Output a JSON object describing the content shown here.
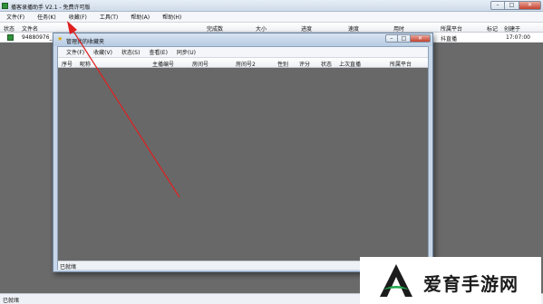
{
  "window": {
    "title": "播客录播助手 V2.1 - 免费许可版"
  },
  "window_controls": {
    "minimize": "–",
    "maximize": "□",
    "close": "✕"
  },
  "menu": [
    "文件(F)",
    "任务(K)",
    "收藏(F)",
    "工具(T)",
    "帮助(A)",
    "帮助(H)"
  ],
  "list_columns": [
    "状态",
    "文件名",
    "完成数",
    "大小",
    "进度",
    "速度",
    "用时",
    "所属平台",
    "标记",
    "创建于"
  ],
  "list_row": {
    "filename": "94880976_150",
    "platform": "抖直播",
    "created": "17:07:00"
  },
  "status_bar": {
    "text": "已就绪"
  },
  "dialog": {
    "title": "管理我的收藏夹",
    "menu": [
      "文件(F)",
      "收藏(V)",
      "状态(S)",
      "查看(E)",
      "同步(U)"
    ],
    "columns": [
      "序号",
      "昵称",
      "主播编号",
      "房间号",
      "房间号2",
      "性别",
      "评分",
      "状态",
      "上次直播",
      "所属平台"
    ],
    "status": "已就绪"
  },
  "watermark": {
    "text": "爱育手游网"
  },
  "colors": {
    "annotation_arrow": "#e02020",
    "app_icon": "#2f8f3a",
    "watermark_green": "#1fa64a"
  }
}
